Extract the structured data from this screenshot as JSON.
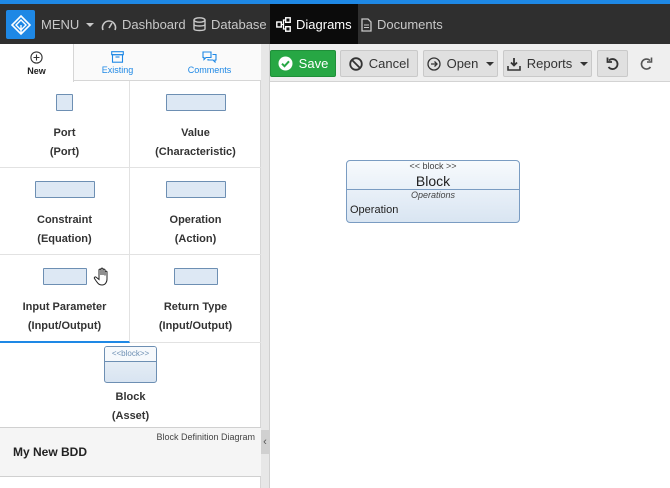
{
  "nav": {
    "menu_label": "MENU",
    "items": [
      {
        "label": "Dashboard",
        "icon": "dashboard-icon"
      },
      {
        "label": "Database",
        "icon": "database-icon"
      },
      {
        "label": "Diagrams",
        "icon": "diagram-icon",
        "active": true
      },
      {
        "label": "Documents",
        "icon": "document-icon"
      }
    ],
    "accent_color": "#1e88e5"
  },
  "sidebar": {
    "tabs": [
      {
        "label": "New",
        "icon": "plus-circle-icon",
        "active": true
      },
      {
        "label": "Existing",
        "icon": "archive-icon"
      },
      {
        "label": "Comments",
        "icon": "comments-icon"
      }
    ],
    "palette": [
      {
        "name": "Port",
        "type": "(Port)"
      },
      {
        "name": "Value",
        "type": "(Characteristic)"
      },
      {
        "name": "Constraint",
        "type": "(Equation)"
      },
      {
        "name": "Operation",
        "type": "(Action)"
      },
      {
        "name": "Input Parameter",
        "type": "(Input/Output)"
      },
      {
        "name": "Return Type",
        "type": "(Input/Output)"
      },
      {
        "name": "Block",
        "type": "(Asset)",
        "stereotype": "<<block>>"
      }
    ],
    "diagram": {
      "type_label": "Block Definition Diagram",
      "title": "My New BDD"
    }
  },
  "toolbar": {
    "save_label": "Save",
    "cancel_label": "Cancel",
    "open_label": "Open",
    "reports_label": "Reports",
    "save_color": "#27a744"
  },
  "canvas": {
    "block": {
      "stereotype": "<< block >>",
      "name": "Block",
      "compartment": "Operations",
      "operation": "Operation"
    }
  }
}
